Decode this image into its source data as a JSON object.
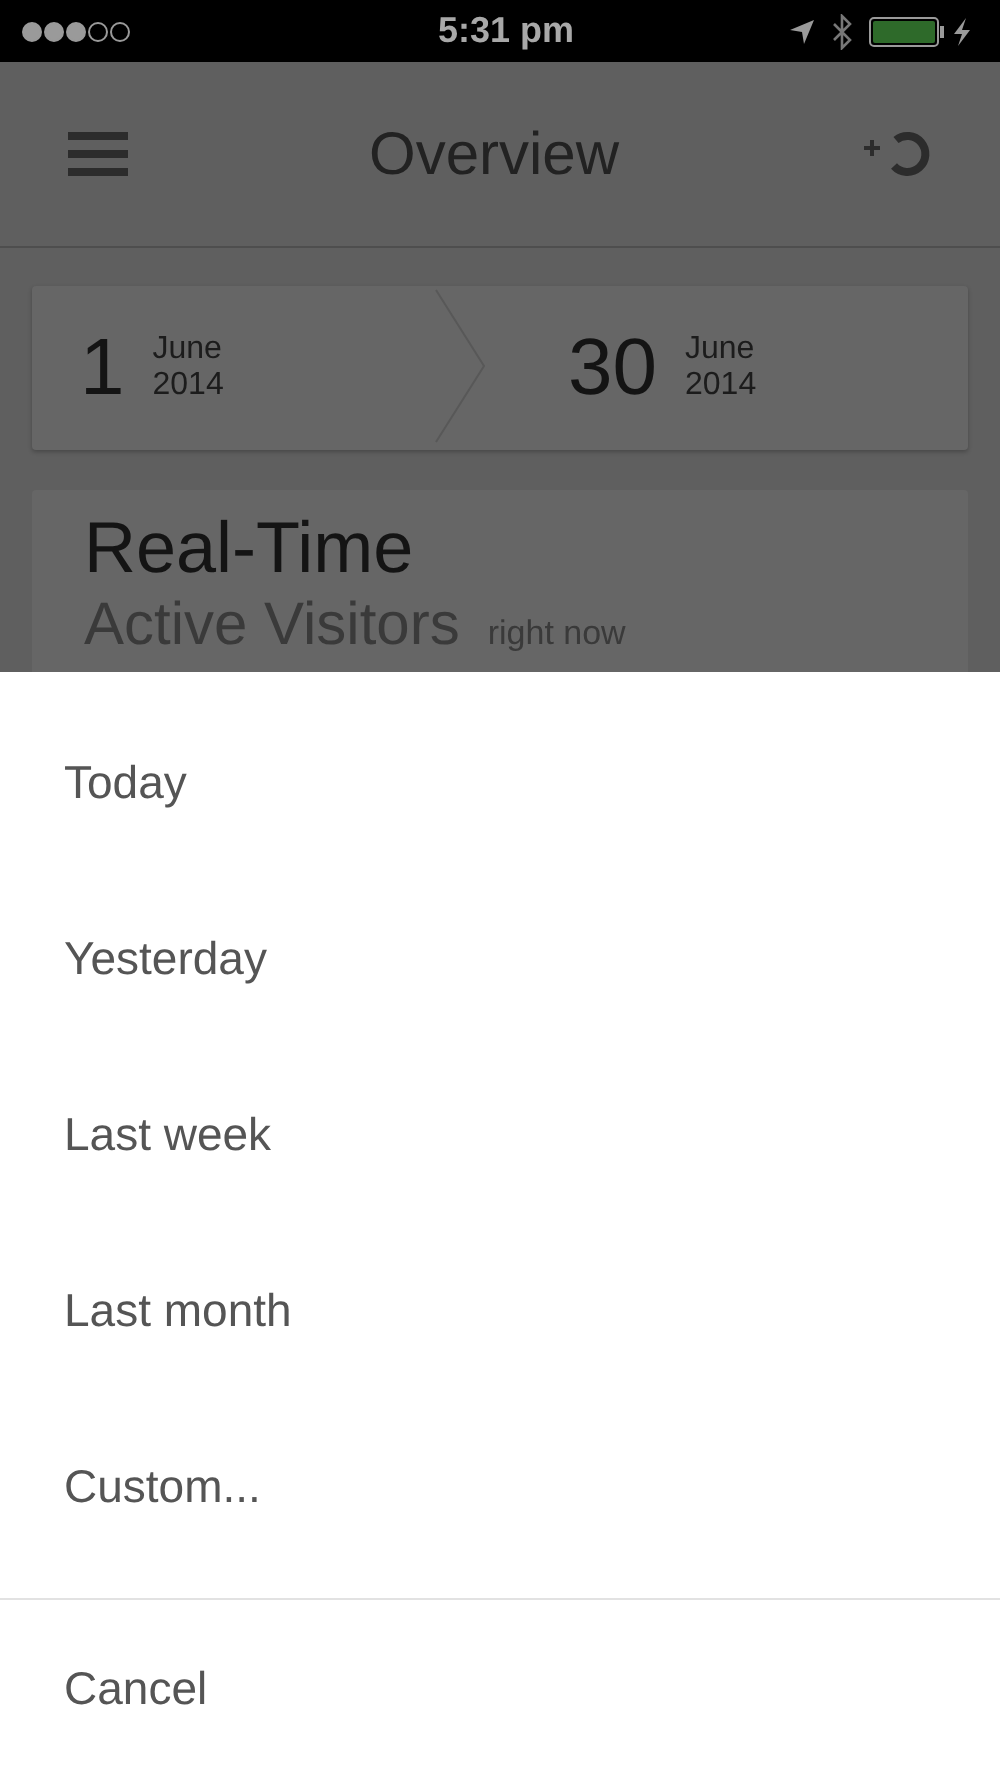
{
  "status_bar": {
    "time": "5:31 pm"
  },
  "nav_bar": {
    "title": "Overview"
  },
  "date_range": {
    "start": {
      "day": "1",
      "month": "June",
      "year": "2014"
    },
    "end": {
      "day": "30",
      "month": "June",
      "year": "2014"
    }
  },
  "realtime_card": {
    "title": "Real-Time",
    "metric": "Active Visitors",
    "period": "right now"
  },
  "action_sheet": {
    "options": [
      "Today",
      "Yesterday",
      "Last week",
      "Last month",
      "Custom..."
    ],
    "cancel": "Cancel"
  }
}
